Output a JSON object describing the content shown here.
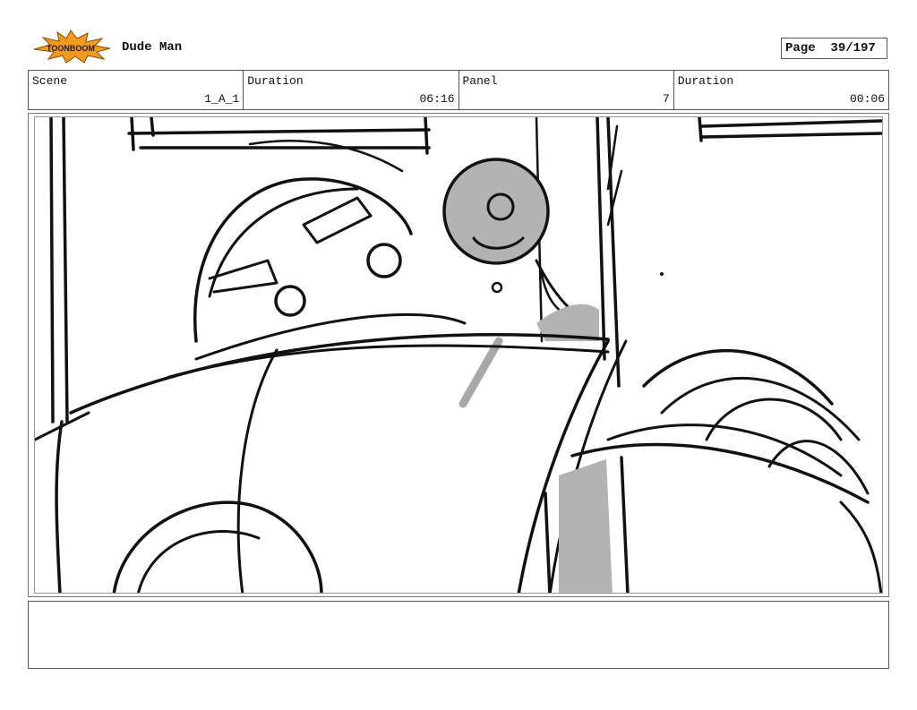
{
  "header": {
    "logo_text": "TOONBOOM",
    "project_title": "Dude Man",
    "page_label": "Page",
    "page_value": "39/197"
  },
  "info": {
    "scene_label": "Scene",
    "scene_value": "1_A_1",
    "duration_label": "Duration",
    "duration_value": "06:16",
    "panel_label": "Panel",
    "panel_value": "7",
    "panel_duration_label": "Duration",
    "panel_duration_value": "00:06"
  },
  "notes": {
    "text": ""
  }
}
